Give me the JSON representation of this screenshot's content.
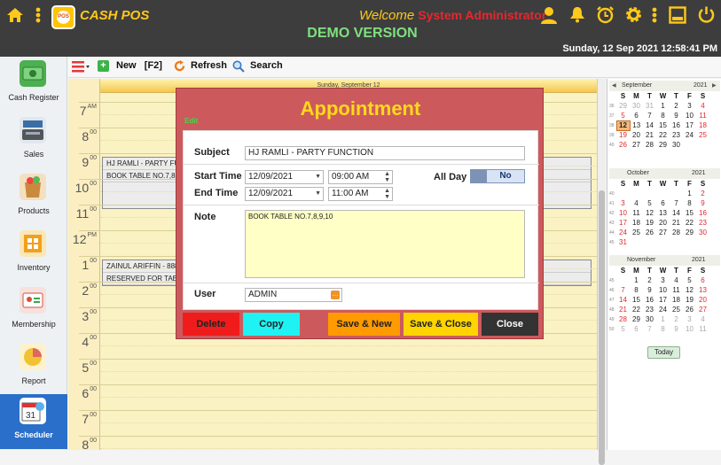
{
  "header": {
    "logo_text": "POS",
    "brand": "CASH POS",
    "welcome_prefix": "Welcome",
    "user": "System Administrator",
    "demo": "DEMO VERSION",
    "datetime": "Sunday, 12 Sep 2021 12:58:41 PM",
    "icons": [
      "home-icon",
      "menu-dots-icon",
      "user-icon",
      "bell-icon",
      "alarm-clock-icon",
      "gear-icon",
      "menu-dots-icon",
      "minimize-icon",
      "power-icon"
    ]
  },
  "sidebar": {
    "items": [
      {
        "label": "Cash Register",
        "icon": "cash-register-icon",
        "color": "#3aa74a"
      },
      {
        "label": "Sales",
        "icon": "sales-icon",
        "color": "#4a7fb5"
      },
      {
        "label": "Products",
        "icon": "products-icon",
        "color": "#e8a23b"
      },
      {
        "label": "Inventory",
        "icon": "inventory-icon",
        "color": "#f0a020"
      },
      {
        "label": "Membership",
        "icon": "membership-icon",
        "color": "#d94e3b"
      },
      {
        "label": "Report",
        "icon": "report-icon",
        "color": "#f1c232"
      },
      {
        "label": "Scheduler",
        "icon": "scheduler-icon",
        "color": "#ffffff"
      }
    ],
    "active": "Scheduler"
  },
  "toolbar": {
    "new_label": "New",
    "new_shortcut": "[F2]",
    "refresh_label": "Refresh",
    "search_label": "Search"
  },
  "scheduler": {
    "day_header": "Sunday, September 12",
    "times": [
      {
        "h": "7",
        "ap": "AM"
      },
      {
        "h": "8",
        "ap": "00"
      },
      {
        "h": "9",
        "ap": "00"
      },
      {
        "h": "10",
        "ap": "00"
      },
      {
        "h": "11",
        "ap": "00"
      },
      {
        "h": "12",
        "ap": "PM"
      },
      {
        "h": "1",
        "ap": "00"
      },
      {
        "h": "2",
        "ap": "00"
      },
      {
        "h": "3",
        "ap": "00"
      },
      {
        "h": "4",
        "ap": "00"
      },
      {
        "h": "5",
        "ap": "00"
      },
      {
        "h": "6",
        "ap": "00"
      },
      {
        "h": "7",
        "ap": "00"
      },
      {
        "h": "8",
        "ap": "00"
      }
    ],
    "events": [
      {
        "title": "HJ RAMLI - PARTY FU",
        "desc": "BOOK TABLE NO.7,8,9"
      },
      {
        "title": "ZAINUL ARIFFIN - 888",
        "desc": "RESERVED FOR TABLE"
      }
    ]
  },
  "calendars": [
    {
      "month": "September",
      "year": "2021",
      "weeks": [
        {
          "wk": "36",
          "days": [
            "29",
            "30",
            "31",
            "1",
            "2",
            "3",
            "4"
          ]
        },
        {
          "wk": "37",
          "days": [
            "5",
            "6",
            "7",
            "8",
            "9",
            "10",
            "11"
          ]
        },
        {
          "wk": "38",
          "days": [
            "12",
            "13",
            "14",
            "15",
            "16",
            "17",
            "18"
          ]
        },
        {
          "wk": "39",
          "days": [
            "19",
            "20",
            "21",
            "22",
            "23",
            "24",
            "25"
          ]
        },
        {
          "wk": "40",
          "days": [
            "26",
            "27",
            "28",
            "29",
            "30",
            "",
            ""
          ]
        }
      ]
    },
    {
      "month": "October",
      "year": "2021",
      "weeks": [
        {
          "wk": "40",
          "days": [
            "",
            "",
            "",
            "",
            "",
            "1",
            "2"
          ]
        },
        {
          "wk": "41",
          "days": [
            "3",
            "4",
            "5",
            "6",
            "7",
            "8",
            "9"
          ]
        },
        {
          "wk": "42",
          "days": [
            "10",
            "11",
            "12",
            "13",
            "14",
            "15",
            "16"
          ]
        },
        {
          "wk": "43",
          "days": [
            "17",
            "18",
            "19",
            "20",
            "21",
            "22",
            "23"
          ]
        },
        {
          "wk": "44",
          "days": [
            "24",
            "25",
            "26",
            "27",
            "28",
            "29",
            "30"
          ]
        },
        {
          "wk": "45",
          "days": [
            "31",
            "",
            "",
            "",
            "",
            "",
            ""
          ]
        }
      ]
    },
    {
      "month": "November",
      "year": "2021",
      "weeks": [
        {
          "wk": "45",
          "days": [
            "",
            "1",
            "2",
            "3",
            "4",
            "5",
            "6"
          ]
        },
        {
          "wk": "46",
          "days": [
            "7",
            "8",
            "9",
            "10",
            "11",
            "12",
            "13"
          ]
        },
        {
          "wk": "47",
          "days": [
            "14",
            "15",
            "16",
            "17",
            "18",
            "19",
            "20"
          ]
        },
        {
          "wk": "48",
          "days": [
            "21",
            "22",
            "23",
            "24",
            "25",
            "26",
            "27"
          ]
        },
        {
          "wk": "49",
          "days": [
            "28",
            "29",
            "30",
            "1",
            "2",
            "3",
            "4"
          ]
        },
        {
          "wk": "50",
          "days": [
            "5",
            "6",
            "7",
            "8",
            "9",
            "10",
            "11"
          ]
        }
      ]
    }
  ],
  "weekday_headers": [
    "S",
    "M",
    "T",
    "W",
    "T",
    "F",
    "S"
  ],
  "today_label": "Today",
  "dialog": {
    "title": "Appointment",
    "mode": "Edit",
    "subject_label": "Subject",
    "subject": "HJ RAMLI - PARTY FUNCTION",
    "start_label": "Start Time",
    "start_date": "12/09/2021",
    "start_time": "09:00 AM",
    "end_label": "End Time",
    "end_date": "12/09/2021",
    "end_time": "11:00 AM",
    "allday_label": "All Day",
    "allday_value": "No",
    "note_label": "Note",
    "note": "BOOK TABLE NO.7,8,9,10",
    "user_label": "User",
    "user": "ADMIN",
    "buttons": {
      "delete": "Delete",
      "copy": "Copy",
      "save_new": "Save & New",
      "save_close": "Save & Close",
      "close": "Close"
    },
    "colors": {
      "delete": "#f01c1c",
      "copy": "#1ef2f2",
      "save_new": "#ff9a00",
      "save_close": "#ffd400",
      "close": "#333333"
    }
  }
}
